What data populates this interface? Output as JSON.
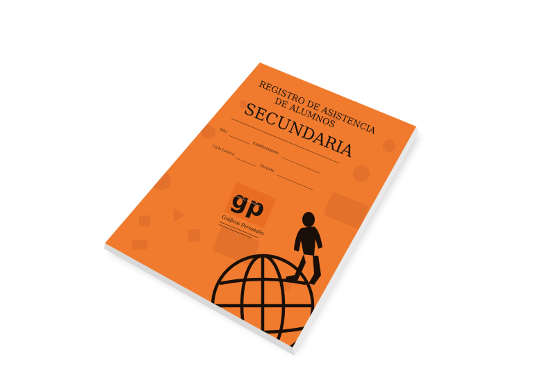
{
  "cover": {
    "heading_line1": "REGISTRO DE ASISTENCIA",
    "heading_line2": "DE ALUMNOS",
    "title": "SECUNDARIA",
    "fields": {
      "year_label": "Año:",
      "school_label": "Establecimiento:",
      "division_label": "División:",
      "cycle_label": "Ciclo Lectivo:"
    },
    "logo": {
      "mark": "gp",
      "tagline": "Gráficas Personales",
      "brand": "Gráficas Personales"
    },
    "colors": {
      "cover": "#f07b2e",
      "pattern": "#d9692a",
      "ink": "#1a120c",
      "page_edge": "#e9e9e9"
    },
    "icons": [
      "globe-icon",
      "walking-person-silhouette",
      "laptop-icon",
      "thumbs-up-icon",
      "chat-bubble-icon",
      "play-button-icon"
    ]
  }
}
